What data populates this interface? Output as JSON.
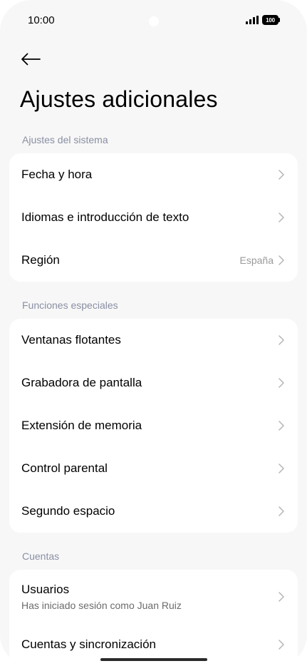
{
  "status_bar": {
    "time": "10:00",
    "battery_level": "100",
    "signal": "signal-icon"
  },
  "header": {
    "back_icon": "arrow-left-icon",
    "title": "Ajustes adicionales"
  },
  "sections": {
    "system": {
      "title": "Ajustes del sistema",
      "items": [
        {
          "label": "Fecha y hora"
        },
        {
          "label": "Idiomas e introducción de texto"
        },
        {
          "label": "Región",
          "value": "España"
        }
      ]
    },
    "special": {
      "title": "Funciones especiales",
      "items": [
        {
          "label": "Ventanas flotantes"
        },
        {
          "label": "Grabadora de pantalla"
        },
        {
          "label": "Extensión de memoria"
        },
        {
          "label": "Control parental"
        },
        {
          "label": "Segundo espacio"
        }
      ]
    },
    "accounts": {
      "title": "Cuentas",
      "items": [
        {
          "label": "Usuarios",
          "subtitle": "Has iniciado sesión como Juan Ruiz"
        },
        {
          "label": "Cuentas y sincronización"
        }
      ]
    }
  },
  "colors": {
    "background": "#f7f7f7",
    "card": "#ffffff",
    "section_header": "#8a8fa3",
    "chevron": "#b5b5b5"
  }
}
